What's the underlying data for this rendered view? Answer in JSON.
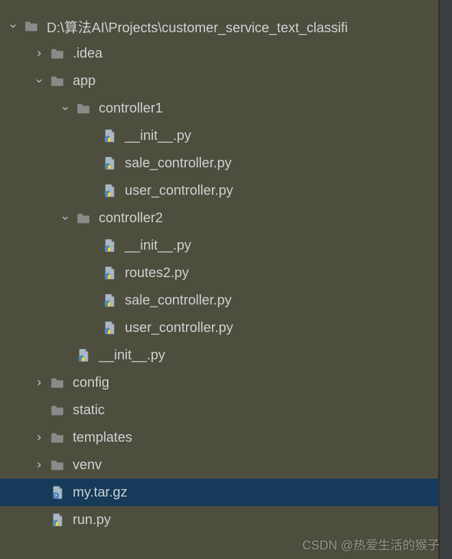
{
  "project_root": "D:\\算法AI\\Projects\\customer_service_text_classifi",
  "selected_item": "my.tar.gz",
  "watermark": "CSDN @热爱生活的猴子",
  "tree": [
    {
      "depth": 0,
      "chevron": "down",
      "icon": "folder",
      "label": "D:\\算法AI\\Projects\\customer_service_text_classifi",
      "interactable": true
    },
    {
      "depth": 1,
      "chevron": "right",
      "icon": "folder",
      "label": ".idea",
      "interactable": true
    },
    {
      "depth": 1,
      "chevron": "down",
      "icon": "folder",
      "label": "app",
      "interactable": true
    },
    {
      "depth": 2,
      "chevron": "down",
      "icon": "folder",
      "label": "controller1",
      "interactable": true
    },
    {
      "depth": 3,
      "chevron": "none",
      "icon": "pyfile",
      "label": "__init__.py",
      "interactable": true
    },
    {
      "depth": 3,
      "chevron": "none",
      "icon": "pyfile",
      "label": "sale_controller.py",
      "interactable": true
    },
    {
      "depth": 3,
      "chevron": "none",
      "icon": "pyfile",
      "label": "user_controller.py",
      "interactable": true
    },
    {
      "depth": 2,
      "chevron": "down",
      "icon": "folder",
      "label": "controller2",
      "interactable": true
    },
    {
      "depth": 3,
      "chevron": "none",
      "icon": "pyfile",
      "label": "__init__.py",
      "interactable": true
    },
    {
      "depth": 3,
      "chevron": "none",
      "icon": "pyfile",
      "label": "routes2.py",
      "interactable": true
    },
    {
      "depth": 3,
      "chevron": "none",
      "icon": "pyfile",
      "label": "sale_controller.py",
      "interactable": true
    },
    {
      "depth": 3,
      "chevron": "none",
      "icon": "pyfile",
      "label": "user_controller.py",
      "interactable": true
    },
    {
      "depth": 2,
      "chevron": "none",
      "icon": "pyfile",
      "label": "__init__.py",
      "interactable": true
    },
    {
      "depth": 1,
      "chevron": "right",
      "icon": "folder",
      "label": "config",
      "interactable": true
    },
    {
      "depth": 1,
      "chevron": "none",
      "icon": "folder",
      "label": "static",
      "interactable": true
    },
    {
      "depth": 1,
      "chevron": "right",
      "icon": "folder",
      "label": "templates",
      "interactable": true
    },
    {
      "depth": 1,
      "chevron": "right",
      "icon": "folder",
      "label": "venv",
      "interactable": true
    },
    {
      "depth": 1,
      "chevron": "none",
      "icon": "unknownfile",
      "label": "my.tar.gz",
      "interactable": true,
      "selected": true
    },
    {
      "depth": 1,
      "chevron": "none",
      "icon": "pyfile",
      "label": "run.py",
      "interactable": true
    }
  ]
}
